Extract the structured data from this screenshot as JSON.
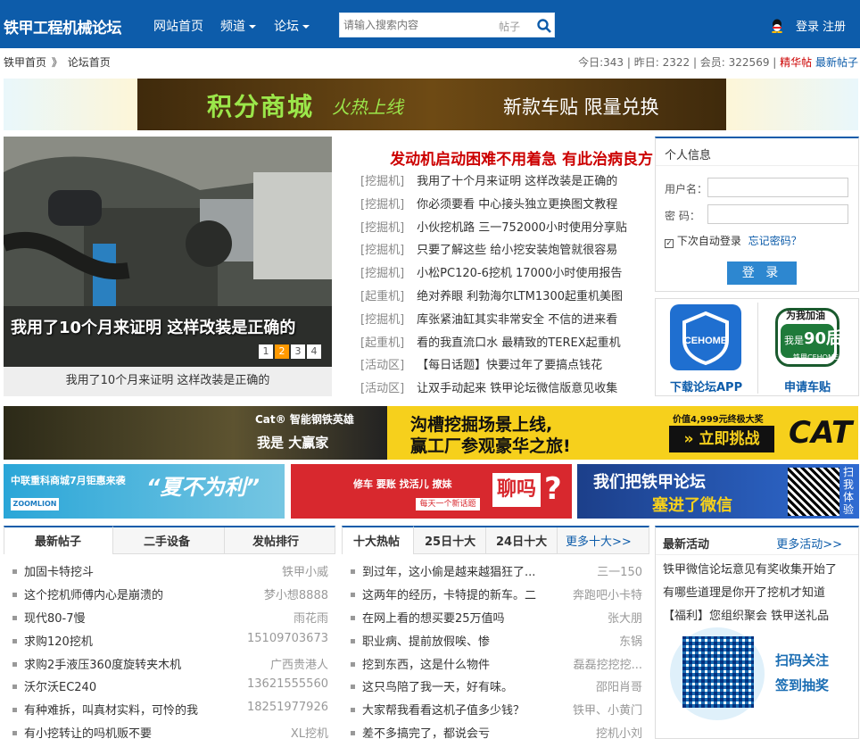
{
  "nav": {
    "logo": "铁甲工程机械论坛",
    "home": "网站首页",
    "channel": "频道",
    "forum": "论坛",
    "search_placeholder": "请输入搜索内容",
    "search_type": "帖子",
    "login": "登录",
    "register": "注册"
  },
  "bar": {
    "crumb_home": "铁甲首页",
    "crumb_sep": "》",
    "crumb_forum": "论坛首页",
    "today": "今日:343",
    "yesterday": "昨日: 2322",
    "members": "会员: 322569",
    "elite": "精华帖",
    "newest": "最新帖子"
  },
  "banner1": {
    "title": "积分商城",
    "sub": "火热上线",
    "right": "新款车贴  限量兑换"
  },
  "slide": {
    "caption_big": "我用了10个月来证明 这样改装是正确的",
    "caption_small": "我用了10个月来证明 这样改装是正确的",
    "pages": [
      "1",
      "2",
      "3",
      "4"
    ],
    "active_page": 2
  },
  "headline": "发动机启动困难不用着急 有此治病良方",
  "threads": [
    {
      "cat": "[挖掘机]",
      "title": "我用了十个月来证明 这样改装是正确的"
    },
    {
      "cat": "[挖掘机]",
      "title": "你必须要看 中心接头独立更换图文教程"
    },
    {
      "cat": "[挖掘机]",
      "title": "小伙挖机路 三一752000小时使用分享贴"
    },
    {
      "cat": "[挖掘机]",
      "title": "只要了解这些 给小挖安装炮管就很容易"
    },
    {
      "cat": "[挖掘机]",
      "title": "小松PC120-6挖机 17000小时使用报告"
    },
    {
      "cat": "[起重机]",
      "title": "绝对养眼 利勃海尔LTM1300起重机美图"
    },
    {
      "cat": "[挖掘机]",
      "title": "库张紧油缸其实非常安全 不信的进来看"
    },
    {
      "cat": "[起重机]",
      "title": "看的我直流口水 最精致的TEREX起重机"
    },
    {
      "cat": "[活动区]",
      "title": "【每日话题】快要过年了要搞点钱花"
    },
    {
      "cat": "[活动区]",
      "title": "让双手动起来 铁甲论坛微信版意见收集"
    }
  ],
  "user": {
    "title": "个人信息",
    "username_label": "用户名：",
    "password_label": "密  码：",
    "remember": "下次自动登录",
    "forgot": "忘记密码？",
    "login_btn": "登 录"
  },
  "apps": {
    "app_label": "下载论坛APP",
    "sticker_label": "申请车贴",
    "sticker_top": "为我加油",
    "sticker_mid": "我是",
    "sticker_num": "90后",
    "sticker_brand": "铁甲CEHOME"
  },
  "cat_banner": {
    "left_title": "Cat® 智能钢铁英雄",
    "badge": "我是 大赢家",
    "line1": "沟槽挖掘场景上线,",
    "line2": "赢工厂参观豪华之旅!",
    "prize": "价值4,999元终极大奖",
    "cta": "立即挑战",
    "brand": "CAT"
  },
  "ban3": {
    "b1_brand": "中联重科商城7月钜惠来袭",
    "b1_title": "“夏不为利”",
    "b1_logo": "ZOOMLION",
    "b2_text": "修车 要账 找活儿 撩妹",
    "b2_big": "聊吗",
    "b2_sub": "每天一个新话题",
    "b3_text1": "我们把铁甲论坛",
    "b3_text2": "塞进了微信",
    "b3_scan": "扫我体验"
  },
  "tabs1": [
    "最新帖子",
    "二手设备",
    "发帖排行"
  ],
  "tabs2": [
    "十大热帖",
    "25日十大",
    "24日十大"
  ],
  "more_top10": "更多十大>>",
  "latest": [
    {
      "t": "加固卡特挖斗",
      "a": "铁甲小威"
    },
    {
      "t": "这个挖机师傅内心是崩溃的",
      "a": "梦小想8888"
    },
    {
      "t": "现代80-7慢",
      "a": "雨花雨"
    },
    {
      "t": "求购120挖机",
      "a": "15109703673"
    },
    {
      "t": "求购2手液压360度旋转夹木机",
      "a": "广西贵港人"
    },
    {
      "t": "沃尔沃EC240",
      "a": "13621555560"
    },
    {
      "t": "有种难拆，叫真材实料，可怜的我",
      "a": "18251977926"
    },
    {
      "t": "有小挖转让的吗机贩不要",
      "a": "XL挖机"
    }
  ],
  "hot": [
    {
      "t": "到过年，这小偷是越来越猖狂了...",
      "a": "三一150"
    },
    {
      "t": "这两年的经历，卡特提的新车。二",
      "a": "奔跑吧小卡特"
    },
    {
      "t": "在网上看的想买要25万值吗",
      "a": "张大朋"
    },
    {
      "t": "职业病、提前放假唉、惨",
      "a": "东锅"
    },
    {
      "t": "挖到东西，这是什么物件",
      "a": "磊磊挖挖挖..."
    },
    {
      "t": "这只鸟陪了我一天，好有味。",
      "a": "邵阳肖哥"
    },
    {
      "t": "大家帮我看看这机子值多少钱？",
      "a": "铁甲、小黄门"
    },
    {
      "t": "差不多搞完了，都说会亏",
      "a": "挖机小刘"
    }
  ],
  "activity": {
    "title": "最新活动",
    "more": "更多活动>>",
    "items": [
      "铁甲微信论坛意见有奖收集开始了",
      "有哪些道理是你开了挖机才知道",
      "【福利】您组织聚会 铁甲送礼品"
    ],
    "qr_text1": "扫码关注",
    "qr_text2": "签到抽奖"
  },
  "colors": {
    "primary": "#0d5caa",
    "accent_red": "#c00",
    "orange": "#f90"
  }
}
